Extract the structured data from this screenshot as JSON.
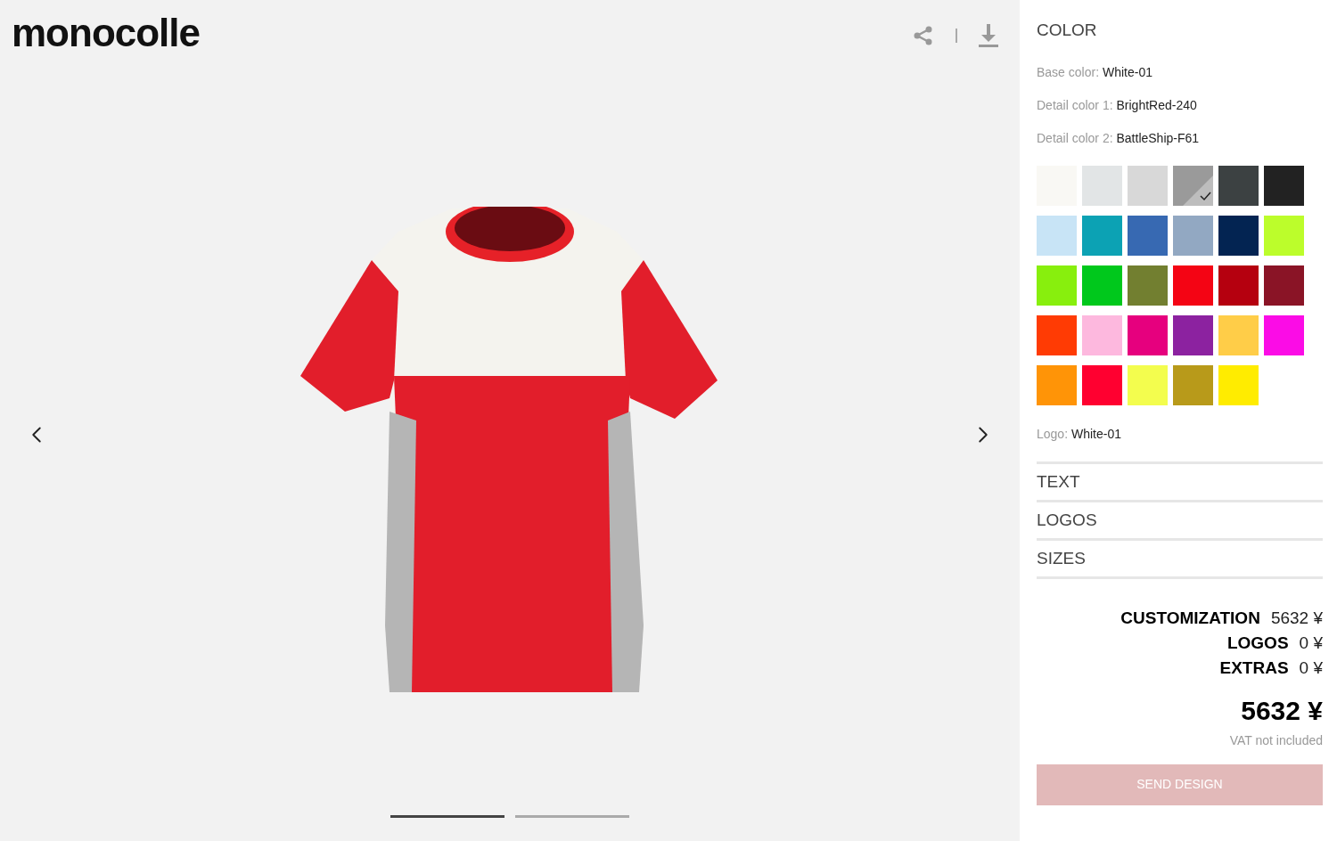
{
  "logo": "monocolle",
  "slides": [
    {
      "selected": true
    },
    {
      "selected": false
    }
  ],
  "color_section": {
    "title": "COLOR",
    "fields": [
      {
        "label": "Base color:",
        "value": "White-01"
      },
      {
        "label": "Detail color 1:",
        "value": "BrightRed-240"
      },
      {
        "label": "Detail color 2:",
        "value": "BattleShip-F61"
      }
    ],
    "swatches": [
      {
        "color": "#f9f8f4",
        "selected": false
      },
      {
        "color": "#e2e5e6",
        "selected": false
      },
      {
        "color": "#d8d8d8",
        "selected": false
      },
      {
        "color": "#9a9a9a",
        "selected": true
      },
      {
        "color": "#3c4142",
        "selected": false
      },
      {
        "color": "#222222",
        "selected": false
      },
      {
        "color": "#c8e4f6",
        "selected": false
      },
      {
        "color": "#0ca2b4",
        "selected": false
      },
      {
        "color": "#3769b2",
        "selected": false
      },
      {
        "color": "#92a8c2",
        "selected": false
      },
      {
        "color": "#032452",
        "selected": false
      },
      {
        "color": "#bcfd2b",
        "selected": false
      },
      {
        "color": "#88ef0d",
        "selected": false
      },
      {
        "color": "#00c81c",
        "selected": false
      },
      {
        "color": "#727f30",
        "selected": false
      },
      {
        "color": "#f40414",
        "selected": false
      },
      {
        "color": "#b5000f",
        "selected": false
      },
      {
        "color": "#8a1426",
        "selected": false
      },
      {
        "color": "#ff3b04",
        "selected": false
      },
      {
        "color": "#fdb8de",
        "selected": false
      },
      {
        "color": "#e6007e",
        "selected": false
      },
      {
        "color": "#8c22a0",
        "selected": false
      },
      {
        "color": "#ffcd48",
        "selected": false
      },
      {
        "color": "#fb0ce6",
        "selected": false
      },
      {
        "color": "#ff9407",
        "selected": false
      },
      {
        "color": "#ff0030",
        "selected": false
      },
      {
        "color": "#f3fd4e",
        "selected": false
      },
      {
        "color": "#b89a1a",
        "selected": false
      },
      {
        "color": "#ffec00",
        "selected": false
      }
    ],
    "logo_field": {
      "label": "Logo:",
      "value": "White-01"
    }
  },
  "sections": [
    {
      "title": "TEXT"
    },
    {
      "title": "LOGOS"
    },
    {
      "title": "SIZES"
    }
  ],
  "pricing": {
    "lines": [
      {
        "label": "CUSTOMIZATION",
        "value": "5632 ¥"
      },
      {
        "label": "LOGOS",
        "value": "0 ¥"
      },
      {
        "label": "EXTRAS",
        "value": "0 ¥"
      }
    ],
    "total": "5632 ¥",
    "note": "VAT not included"
  },
  "send_button": {
    "label": "SEND DESIGN",
    "disabled": true
  }
}
